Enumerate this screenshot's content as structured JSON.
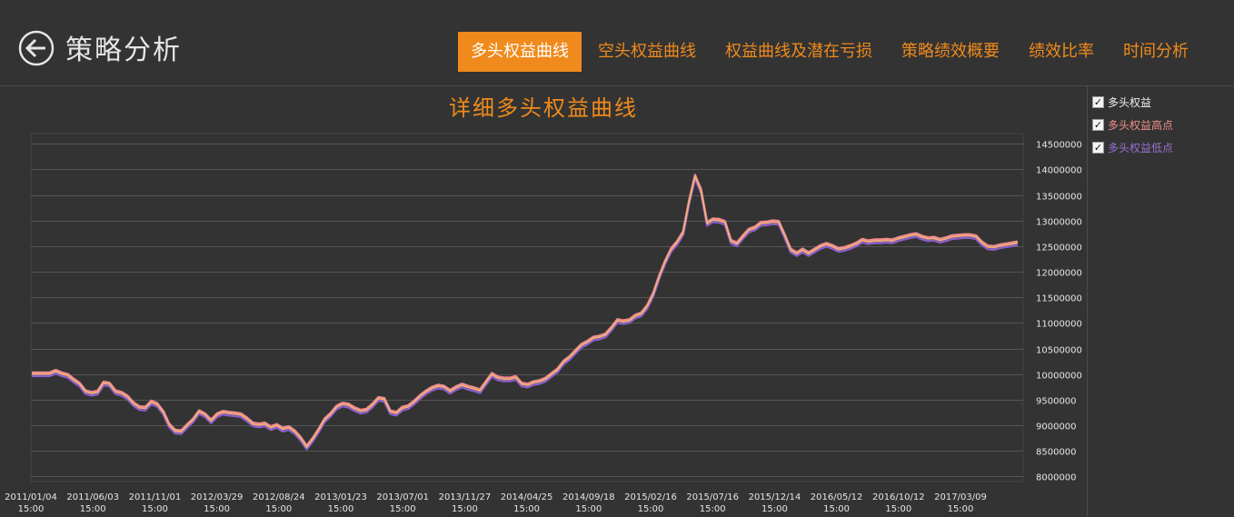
{
  "header": {
    "title": "策略分析",
    "tabs": [
      {
        "label": "多头权益曲线",
        "active": true
      },
      {
        "label": "空头权益曲线",
        "active": false
      },
      {
        "label": "权益曲线及潜在亏损",
        "active": false
      },
      {
        "label": "策略绩效概要",
        "active": false
      },
      {
        "label": "绩效比率",
        "active": false
      },
      {
        "label": "时间分析",
        "active": false
      }
    ]
  },
  "legend": {
    "items": [
      {
        "label": "多头权益",
        "checked": true,
        "color": "#f0f0f0"
      },
      {
        "label": "多头权益高点",
        "checked": true,
        "color": "#f08d8d"
      },
      {
        "label": "多头权益低点",
        "checked": true,
        "color": "#9a6fd0"
      }
    ]
  },
  "colors": {
    "accent": "#f08a1c",
    "equity": "#f2b07a",
    "high": "#f08d8d",
    "low": "#8a5fc8",
    "grid": "#555555"
  },
  "chart_data": {
    "type": "line",
    "title": "详细多头权益曲线",
    "ylim": [
      7900000,
      14700000
    ],
    "yticks": [
      8000000,
      8500000,
      9000000,
      9500000,
      10000000,
      10500000,
      11000000,
      11500000,
      12000000,
      12500000,
      13000000,
      13500000,
      14000000,
      14500000
    ],
    "ytick_labels": [
      "8000000",
      "8500000",
      "9000000",
      "9500000",
      "10000000",
      "10500000",
      "11000000",
      "11500000",
      "12000000",
      "12500000",
      "13000000",
      "13500000",
      "14000000",
      "14500000"
    ],
    "xtick_labels": [
      [
        "2011/01/04",
        "15:00"
      ],
      [
        "2011/06/03",
        "15:00"
      ],
      [
        "2011/11/01",
        "15:00"
      ],
      [
        "2012/03/29",
        "15:00"
      ],
      [
        "2012/08/24",
        "15:00"
      ],
      [
        "2013/01/23",
        "15:00"
      ],
      [
        "2013/07/01",
        "15:00"
      ],
      [
        "2013/11/27",
        "15:00"
      ],
      [
        "2014/04/25",
        "15:00"
      ],
      [
        "2014/09/18",
        "15:00"
      ],
      [
        "2015/02/16",
        "15:00"
      ],
      [
        "2015/07/16",
        "15:00"
      ],
      [
        "2015/12/14",
        "15:00"
      ],
      [
        "2016/05/12",
        "15:00"
      ],
      [
        "2016/10/12",
        "15:00"
      ],
      [
        "2017/03/09",
        "15:00"
      ]
    ],
    "grid": true,
    "legend_position": "right",
    "series": [
      {
        "name": "多头权益",
        "values": [
          10000000,
          10000000,
          10000000,
          10000000,
          10050000,
          10000000,
          9970000,
          9880000,
          9800000,
          9650000,
          9620000,
          9640000,
          9820000,
          9800000,
          9650000,
          9620000,
          9550000,
          9420000,
          9340000,
          9330000,
          9450000,
          9400000,
          9250000,
          9000000,
          8880000,
          8870000,
          8990000,
          9100000,
          9260000,
          9200000,
          9080000,
          9200000,
          9250000,
          9230000,
          9220000,
          9200000,
          9120000,
          9020000,
          9000000,
          9020000,
          8950000,
          8990000,
          8920000,
          8950000,
          8870000,
          8740000,
          8570000,
          8720000,
          8900000,
          9100000,
          9210000,
          9350000,
          9410000,
          9390000,
          9320000,
          9270000,
          9290000,
          9390000,
          9520000,
          9500000,
          9260000,
          9230000,
          9330000,
          9360000,
          9450000,
          9560000,
          9650000,
          9720000,
          9760000,
          9740000,
          9660000,
          9730000,
          9780000,
          9740000,
          9710000,
          9670000,
          9830000,
          9990000,
          9920000,
          9900000,
          9900000,
          9930000,
          9800000,
          9780000,
          9830000,
          9850000,
          9900000,
          9990000,
          10080000,
          10230000,
          10320000,
          10440000,
          10560000,
          10620000,
          10700000,
          10720000,
          10760000,
          10890000,
          11040000,
          11020000,
          11040000,
          11130000,
          11170000,
          11320000,
          11560000,
          11900000,
          12190000,
          12430000,
          12570000,
          12760000,
          13360000,
          13860000,
          13580000,
          12940000,
          13010000,
          13000000,
          12960000,
          12590000,
          12540000,
          12680000,
          12810000,
          12850000,
          12940000,
          12950000,
          12970000,
          12960000,
          12700000,
          12420000,
          12350000,
          12420000,
          12350000,
          12420000,
          12490000,
          12530000,
          12490000,
          12430000,
          12450000,
          12490000,
          12540000,
          12610000,
          12580000,
          12600000,
          12600000,
          12610000,
          12600000,
          12640000,
          12670000,
          12700000,
          12720000,
          12670000,
          12640000,
          12650000,
          12610000,
          12640000,
          12680000,
          12690000,
          12700000,
          12700000,
          12680000,
          12560000,
          12480000,
          12470000,
          12500000,
          12520000,
          12540000,
          12560000
        ]
      }
    ]
  }
}
